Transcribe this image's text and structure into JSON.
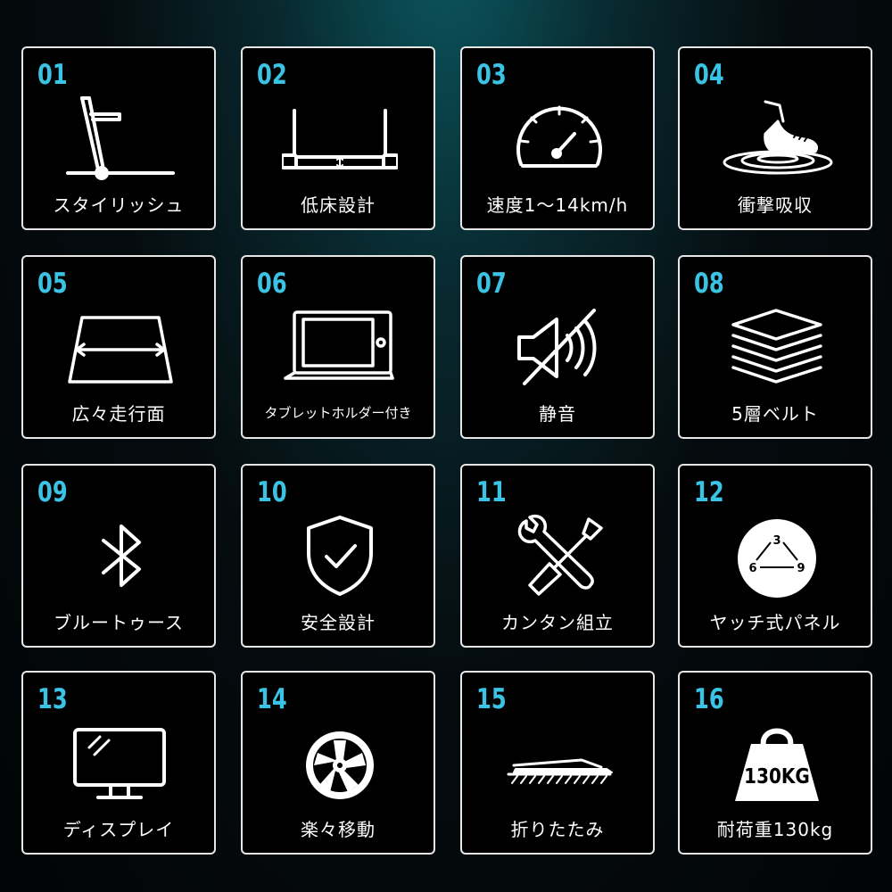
{
  "colors": {
    "accent": "#3bc3e6",
    "border": "#e6e6e6",
    "text": "#ffffff"
  },
  "features": [
    {
      "number": "01",
      "label": "スタイリッシュ",
      "icon": "treadmill-icon"
    },
    {
      "number": "02",
      "label": "低床設計",
      "icon": "low-deck-icon"
    },
    {
      "number": "03",
      "label": "速度1～14km/h",
      "icon": "speedometer-icon"
    },
    {
      "number": "04",
      "label": "衝撃吸収",
      "icon": "shock-absorb-shoe-icon"
    },
    {
      "number": "05",
      "label": "広々走行面",
      "icon": "wide-belt-icon"
    },
    {
      "number": "06",
      "label": "タブレットホルダー付き",
      "icon": "tablet-holder-icon"
    },
    {
      "number": "07",
      "label": "静音",
      "icon": "mute-speaker-icon"
    },
    {
      "number": "08",
      "label": "5層ベルト",
      "icon": "layers-icon"
    },
    {
      "number": "09",
      "label": "ブルートゥース",
      "icon": "bluetooth-icon"
    },
    {
      "number": "10",
      "label": "安全設計",
      "icon": "shield-check-icon"
    },
    {
      "number": "11",
      "label": "カンタン組立",
      "icon": "tools-icon"
    },
    {
      "number": "12",
      "label": "ヤッチ式パネル",
      "icon": "dial-panel-icon"
    },
    {
      "number": "13",
      "label": "ディスプレイ",
      "icon": "monitor-icon"
    },
    {
      "number": "14",
      "label": "楽々移動",
      "icon": "wheel-icon"
    },
    {
      "number": "15",
      "label": "折りたたみ",
      "icon": "fold-icon"
    },
    {
      "number": "16",
      "label": "耐荷重130kg",
      "icon": "weight-icon"
    }
  ],
  "dial": {
    "top": "3",
    "left": "6",
    "right": "9"
  },
  "weight_text": "130KG"
}
